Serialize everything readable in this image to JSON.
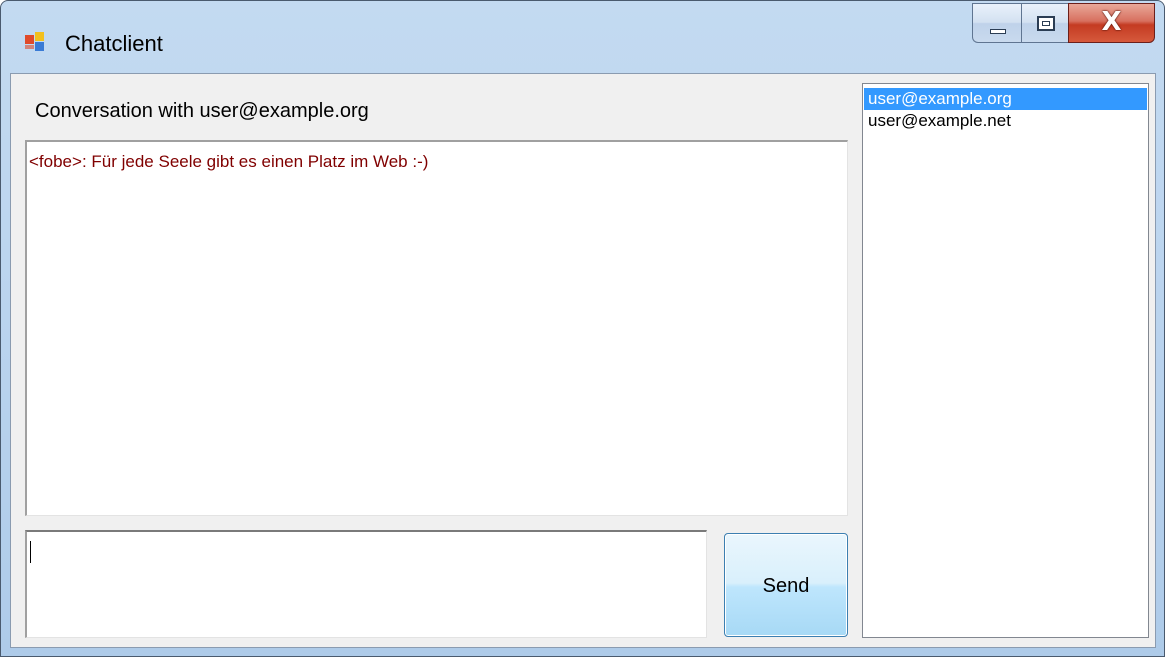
{
  "window": {
    "title": "Chatclient",
    "close_glyph": "X"
  },
  "conversation": {
    "label": "Conversation with user@example.org",
    "messages": [
      {
        "text": "<fobe>: Für jede Seele gibt es einen Platz im Web :-)",
        "color": "#800000"
      }
    ]
  },
  "composer": {
    "value": "",
    "send_label": "Send"
  },
  "users": {
    "items": [
      {
        "label": "user@example.org",
        "selected": true
      },
      {
        "label": "user@example.net",
        "selected": false
      }
    ],
    "selection_color": "#3399ff"
  },
  "icons": {
    "app": "app-window-icon",
    "minimize": "minimize-icon",
    "maximize": "maximize-icon",
    "close": "close-icon"
  }
}
